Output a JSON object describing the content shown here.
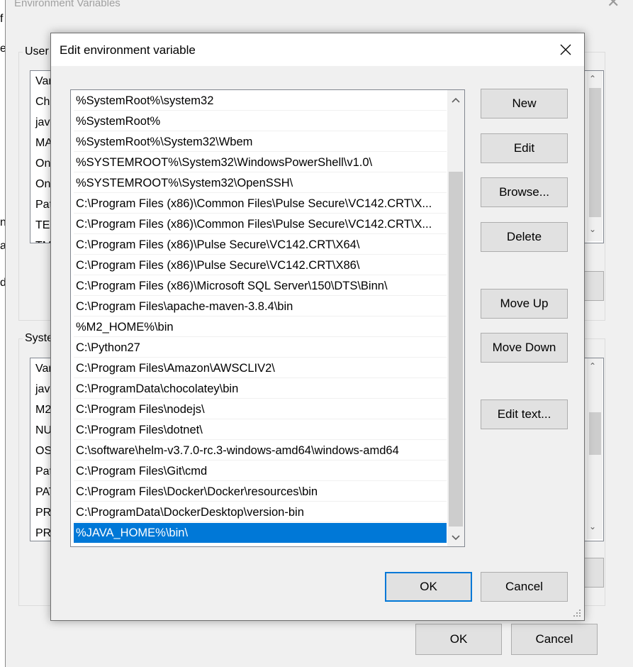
{
  "outer": {
    "title": "Environment Variables",
    "user_group_label": "User",
    "system_group_label": "Syste",
    "user_rows": [
      "Var",
      "Ch",
      "jav",
      "MA",
      "On",
      "On",
      "Pat",
      "TEI",
      "TM"
    ],
    "system_rows": [
      "Var",
      "jav",
      "M2",
      "NU",
      "OS",
      "Pat",
      "PAT",
      "PR",
      "PR"
    ],
    "ok_label": "OK",
    "cancel_label": "Cancel",
    "left_strip": [
      "f",
      "e",
      "n",
      "a",
      "d"
    ]
  },
  "dialog": {
    "title": "Edit environment variable",
    "paths": [
      "%SystemRoot%\\system32",
      "%SystemRoot%",
      "%SystemRoot%\\System32\\Wbem",
      "%SYSTEMROOT%\\System32\\WindowsPowerShell\\v1.0\\",
      "%SYSTEMROOT%\\System32\\OpenSSH\\",
      "C:\\Program Files (x86)\\Common Files\\Pulse Secure\\VC142.CRT\\X...",
      "C:\\Program Files (x86)\\Common Files\\Pulse Secure\\VC142.CRT\\X...",
      "C:\\Program Files (x86)\\Pulse Secure\\VC142.CRT\\X64\\",
      "C:\\Program Files (x86)\\Pulse Secure\\VC142.CRT\\X86\\",
      "C:\\Program Files (x86)\\Microsoft SQL Server\\150\\DTS\\Binn\\",
      "C:\\Program Files\\apache-maven-3.8.4\\bin",
      "%M2_HOME%\\bin",
      "C:\\Python27",
      "C:\\Program Files\\Amazon\\AWSCLIV2\\",
      "C:\\ProgramData\\chocolatey\\bin",
      "C:\\Program Files\\nodejs\\",
      "C:\\Program Files\\dotnet\\",
      "C:\\software\\helm-v3.7.0-rc.3-windows-amd64\\windows-amd64",
      "C:\\Program Files\\Git\\cmd",
      "C:\\Program Files\\Docker\\Docker\\resources\\bin",
      "C:\\ProgramData\\DockerDesktop\\version-bin",
      "%JAVA_HOME%\\bin\\"
    ],
    "selected_path": "%JAVA_HOME%\\bin\\",
    "buttons": {
      "new": "New",
      "edit": "Edit",
      "browse": "Browse...",
      "delete": "Delete",
      "move_up": "Move Up",
      "move_down": "Move Down",
      "edit_text": "Edit text..."
    },
    "ok_label": "OK",
    "cancel_label": "Cancel"
  },
  "colors": {
    "selection": "#0078d7",
    "button_face": "#e1e1e1",
    "window_bg": "#f0f0f0"
  }
}
